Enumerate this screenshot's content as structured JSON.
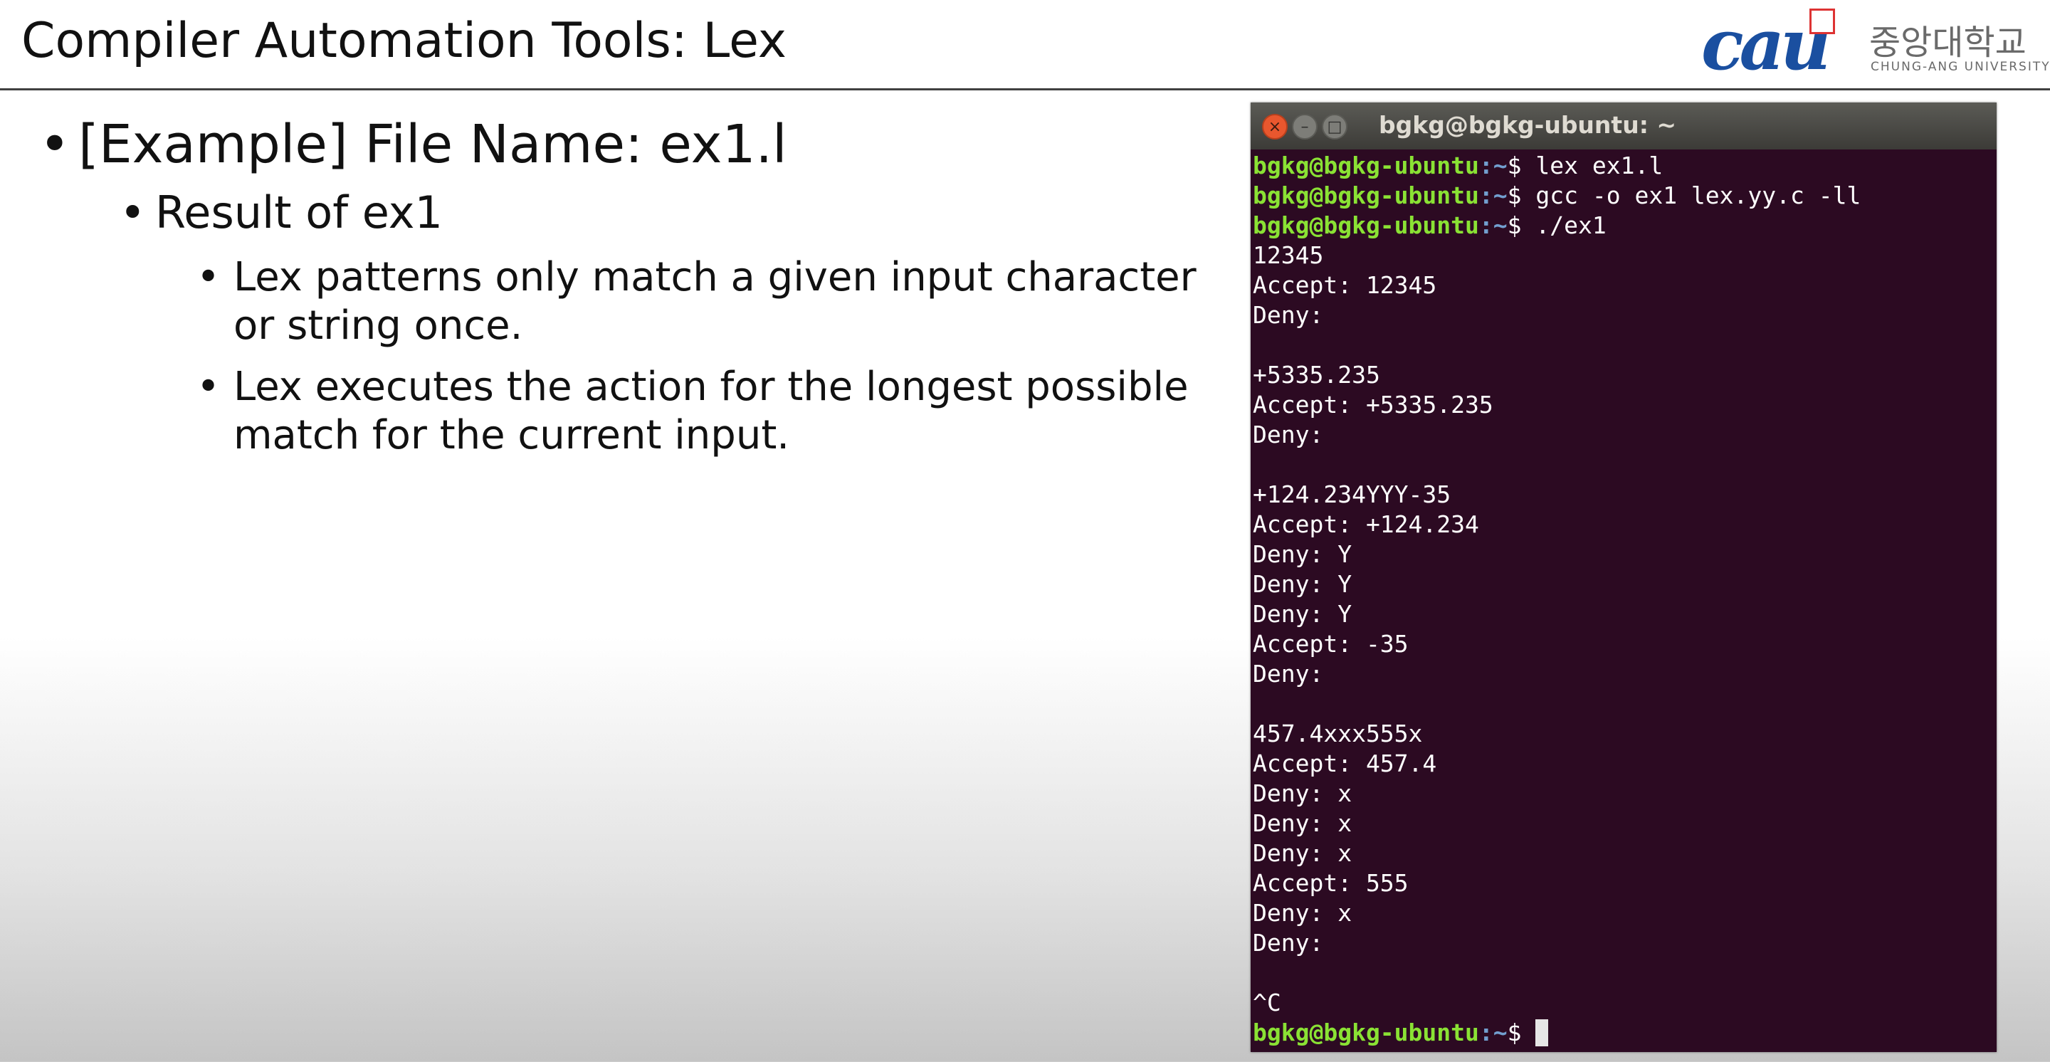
{
  "slide": {
    "title": "Compiler Automation Tools: Lex",
    "logo": {
      "mark": "CAU",
      "korean": "중앙대학교",
      "english": "CHUNG-ANG UNIVERSITY"
    },
    "bullets": {
      "level1": "[Example] File Name: ex1.l",
      "level2": "Result of ex1",
      "level3a_line1": "Lex patterns only match a given input character",
      "level3a_line2": "or string once.",
      "level3b_line1": "Lex executes the action for the longest possible",
      "level3b_line2": "match for the current input.",
      "marker": "•"
    }
  },
  "terminal": {
    "title": "bgkg@bgkg-ubuntu: ~",
    "buttons": {
      "close": "×",
      "minimize": "–",
      "maximize": "□"
    },
    "prompt_user": "bgkg@bgkg-ubuntu",
    "prompt_path": ":~",
    "prompt_symbol": "$ ",
    "commands": [
      "lex ex1.l",
      "gcc -o ex1 lex.yy.c -ll",
      "./ex1"
    ],
    "output": [
      "12345",
      "Accept: 12345",
      "Deny:",
      "",
      "+5335.235",
      "Accept: +5335.235",
      "Deny:",
      "",
      "+124.234YYY-35",
      "Accept: +124.234",
      "Deny: Y",
      "Deny: Y",
      "Deny: Y",
      "Accept: -35",
      "Deny:",
      "",
      "457.4xxx555x",
      "Accept: 457.4",
      "Deny: x",
      "Deny: x",
      "Deny: x",
      "Accept: 555",
      "Deny: x",
      "Deny:",
      "",
      "^C"
    ],
    "colors": {
      "background": "#2c0a22",
      "user": "#8ae234",
      "path": "#729fcf",
      "text": "#ffffff"
    }
  }
}
